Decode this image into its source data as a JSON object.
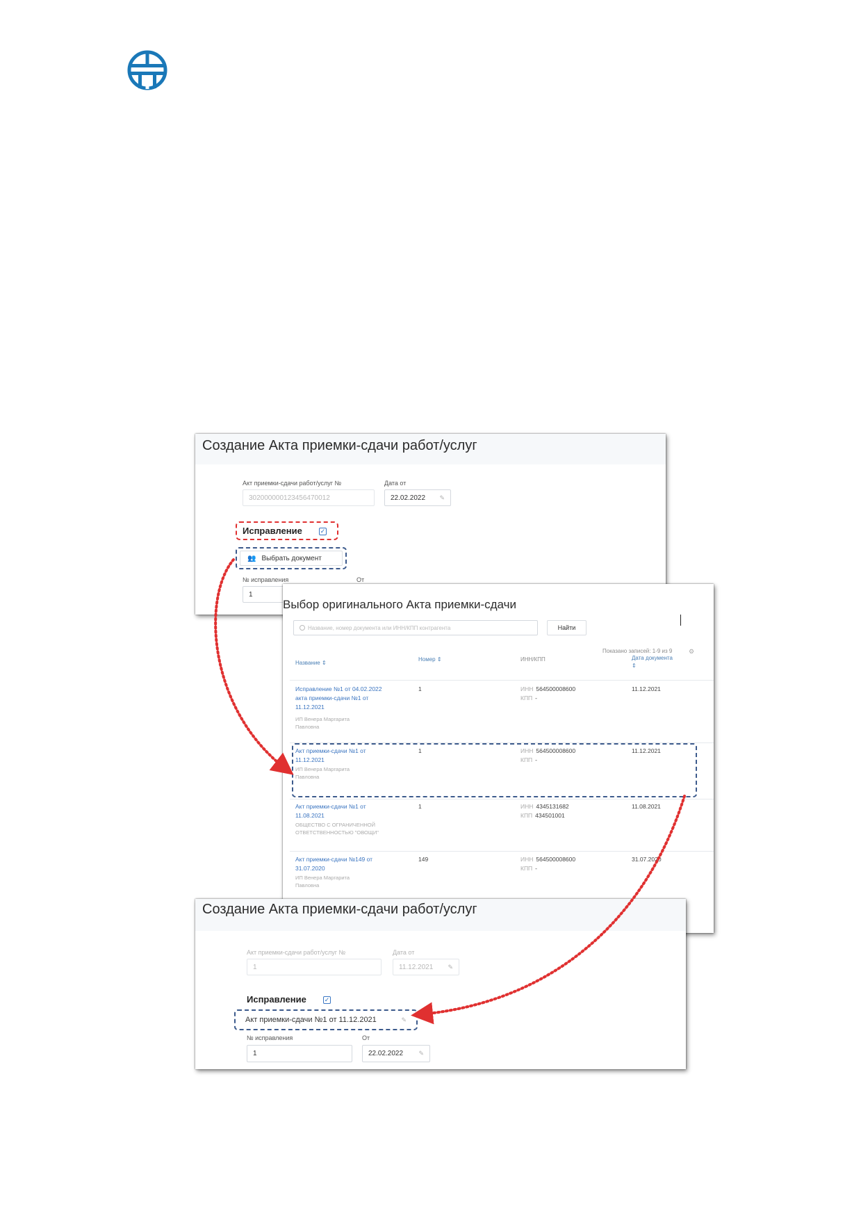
{
  "panel1": {
    "title": "Создание Акта приемки-сдачи работ/услуг",
    "act_label": "Акт приемки-сдачи работ/услуг №",
    "act_value": "302000000123456470012",
    "date_label": "Дата от",
    "date_value": "22.02.2022",
    "correction_label": "Исправление",
    "select_doc_button": "Выбрать документ",
    "corr_num_label": "№ исправления",
    "from_label": "От",
    "corr_num_value": "1"
  },
  "panel2": {
    "title": "Выбор оригинального Акта приемки-сдачи",
    "search_placeholder": "Название, номер документа или ИНН/КПП контрагента",
    "find_button": "Найти",
    "shown_records": "Показано записей: 1-9 из 9",
    "columns": {
      "name": "Название",
      "number": "Номер",
      "inn_kpp": "ИНН/КПП",
      "date": "Дата документа"
    },
    "inn_tag": "ИНН",
    "kpp_tag": "КПП",
    "rows": [
      {
        "name": "Исправление №1 от 04.02.2022 акта приемки-сдачи №1 от 11.12.2021",
        "org": "ИП Венера Маргарита Павловна",
        "number": "1",
        "inn": "564500008600",
        "kpp": "-",
        "date": "11.12.2021"
      },
      {
        "name": "Акт приемки-сдачи №1 от 11.12.2021",
        "org": "ИП Венера Маргарита Павловна",
        "number": "1",
        "inn": "564500008600",
        "kpp": "-",
        "date": "11.12.2021"
      },
      {
        "name": "Акт приемки-сдачи №1 от 11.08.2021",
        "org": "ОБЩЕСТВО С ОГРАНИЧЕННОЙ ОТВЕТСТВЕННОСТЬЮ \"ОВОЩИ\"",
        "number": "1",
        "inn": "4345131682",
        "kpp": "434501001",
        "date": "11.08.2021"
      },
      {
        "name": "Акт приемки-сдачи №149 от 31.07.2020",
        "org": "ИП Венера Маргарита Павловна",
        "number": "149",
        "inn": "564500008600",
        "kpp": "-",
        "date": "31.07.2020"
      }
    ]
  },
  "panel3": {
    "title": "Создание Акта приемки-сдачи работ/услуг",
    "act_label": "Акт приемки-сдачи работ/услуг №",
    "act_value": "1",
    "date_label": "Дата от",
    "date_value": "11.12.2021",
    "correction_label": "Исправление",
    "selected_doc": "Акт приемки-сдачи №1 от 11.12.2021",
    "corr_num_label": "№ исправления",
    "from_label": "От",
    "corr_num_value": "1",
    "corr_date_value": "22.02.2022"
  },
  "colors": {
    "accent": "#3a74c0",
    "dash_red": "#e03030",
    "dash_blue": "#3c5a8c",
    "logo": "#1a78b8"
  },
  "icons": {
    "calendar": "✎",
    "check": "✓",
    "user_add": "person-add-icon"
  }
}
